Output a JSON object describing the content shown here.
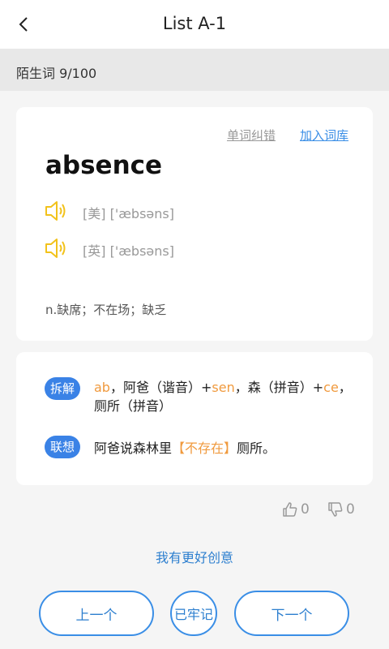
{
  "header": {
    "title": "List A-1",
    "back_icon": "chevron-left-icon"
  },
  "progress": {
    "label": "陌生词 9/100"
  },
  "word_card": {
    "correct_link": "单词纠错",
    "add_link": "加入词库",
    "word": "absence",
    "us_phonetic": "[美] ['æbsəns]",
    "uk_phonetic": "[英] ['æbsəns]",
    "meaning": "n.缺席；不在场；缺乏",
    "speaker_color": "#f2c21b"
  },
  "assoc_card": {
    "split_badge": "拆解",
    "split_parts": [
      "ab",
      "，阿爸（谐音）+",
      "sen",
      "，森（拼音）+",
      "ce",
      "，厕所（拼音）"
    ],
    "assoc_badge": "联想",
    "story_parts": [
      "阿爸说森林里",
      "【不存在】",
      "厕所。"
    ]
  },
  "feedback": {
    "likes": "0",
    "dislikes": "0"
  },
  "better_idea": "我有更好创意",
  "buttons": {
    "prev": "上一个",
    "known": "已牢记",
    "next": "下一个"
  },
  "colors": {
    "accent": "#3a8ee6",
    "highlight": "#f09a3e",
    "badge": "#3a82e6"
  }
}
